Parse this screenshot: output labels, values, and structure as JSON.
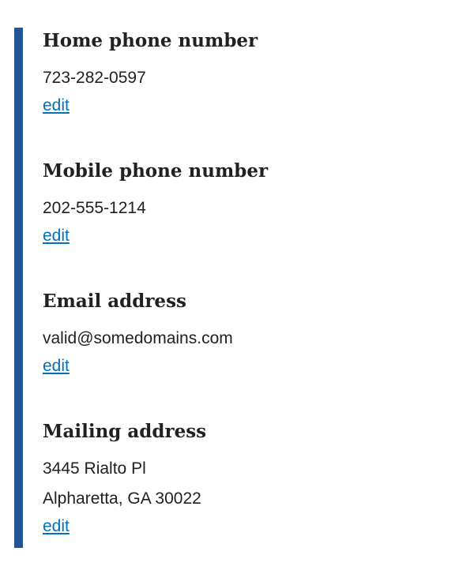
{
  "contact": {
    "home_phone": {
      "heading": "Home phone number",
      "value": "723-282-0597",
      "edit_label": "edit"
    },
    "mobile_phone": {
      "heading": "Mobile phone number",
      "value": "202-555-1214",
      "edit_label": "edit"
    },
    "email": {
      "heading": "Email address",
      "value": "valid@somedomains.com",
      "edit_label": "edit"
    },
    "mailing_address": {
      "heading": "Mailing address",
      "line1": "3445 Rialto Pl",
      "line2": "Alpharetta, GA 30022",
      "edit_label": "edit"
    }
  },
  "colors": {
    "accent_border": "#205493",
    "link": "#0071bb",
    "text": "#212121"
  }
}
